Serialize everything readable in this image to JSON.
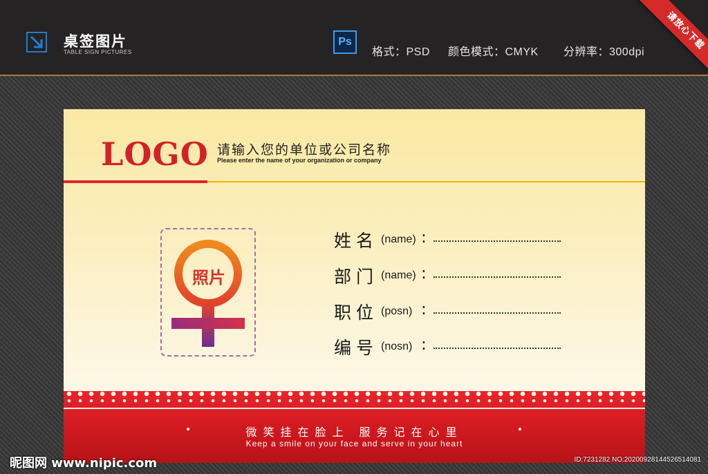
{
  "header": {
    "title": "桌签图片",
    "subtitle": "TABLE SIGN PICTURES",
    "ps_icon_text": "Ps",
    "format": "格式：PSD",
    "color_mode": "颜色模式：CMYK",
    "resolution": "分辨率：300dpi",
    "ribbon": "请放心下载"
  },
  "card": {
    "logo": "LOGO",
    "company_cn": "请输入您的单位或公司名称",
    "company_en": "Please enter the name of your organization or company",
    "photo_label": "照片",
    "fields": [
      {
        "label": "姓名",
        "sub": "(name)",
        "colon": ":"
      },
      {
        "label": "部门",
        "sub": "(name)",
        "colon": ":"
      },
      {
        "label": "职位",
        "sub": "(posn)",
        "colon": ":"
      },
      {
        "label": "编号",
        "sub": "(nosn)",
        "colon": ":"
      }
    ],
    "slogan_cn": "微笑挂在脸上 服务记在心里",
    "slogan_en": "Keep a smile on your face and serve in your heart"
  },
  "watermark": {
    "site": "昵图网 www.nipic.com",
    "id": "ID:7231282 NO:20200928144526514081"
  },
  "colors": {
    "accent_red": "#e0242a",
    "gold": "#f2b300",
    "ps_blue": "#3d9be9",
    "topbar": "#262324"
  },
  "icons": [
    "download-arrow-icon",
    "photoshop-icon",
    "female-symbol-icon"
  ]
}
